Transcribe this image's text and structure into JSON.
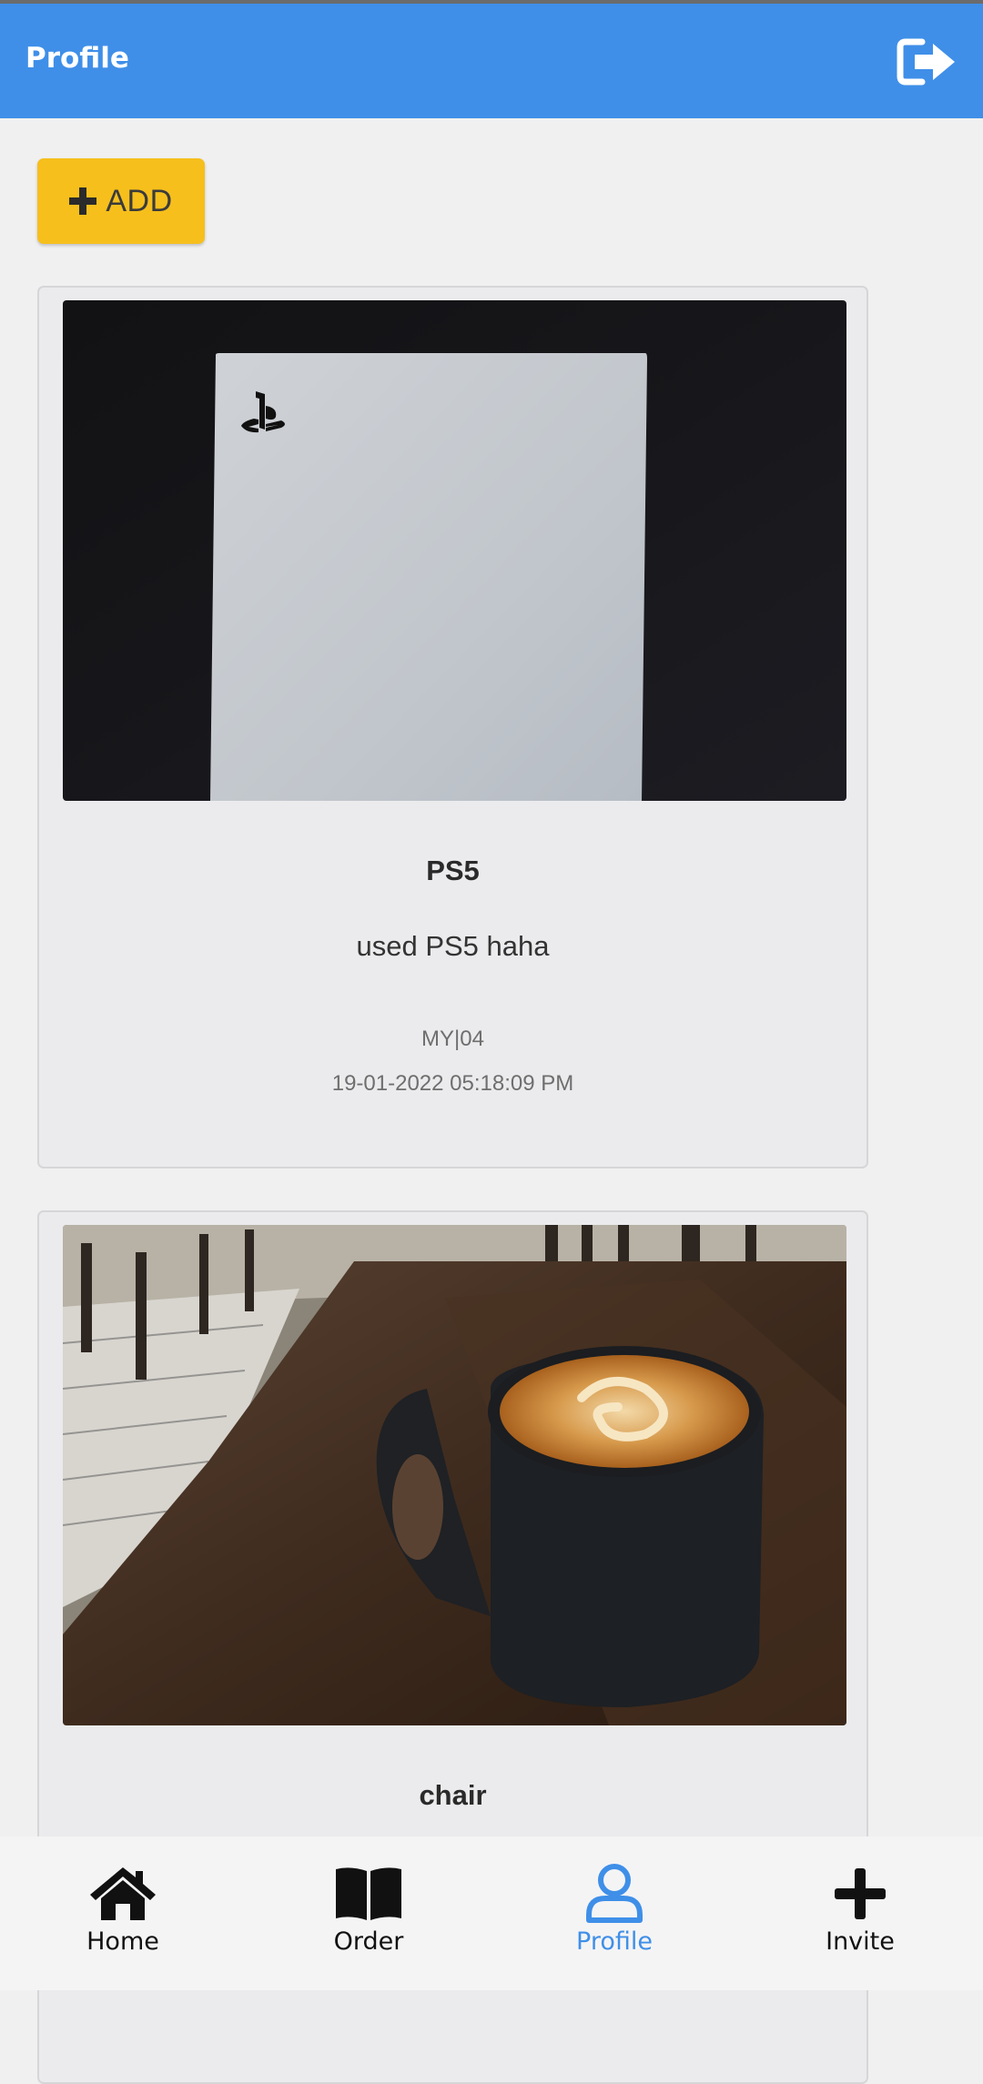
{
  "app": {
    "title": "Profile",
    "accent_color": "#3f8fe8",
    "logout_icon": "logout-icon"
  },
  "actions": {
    "add_label": "ADD",
    "add_icon": "plus-icon",
    "add_color": "#f6bf1c"
  },
  "posts": [
    {
      "image": "ps5-console-photo",
      "title": "PS5",
      "description": "used PS5 haha",
      "location": "MY|04",
      "date": "19-01-2022 05:18:09 PM"
    },
    {
      "image": "coffee-mug-photo",
      "title": "chair"
    }
  ],
  "nav": {
    "items": [
      {
        "label": "Home",
        "icon": "home-icon"
      },
      {
        "label": "Order",
        "icon": "book-icon"
      },
      {
        "label": "Profile",
        "icon": "user-icon",
        "active": true
      },
      {
        "label": "Invite",
        "icon": "plus-icon"
      }
    ]
  }
}
